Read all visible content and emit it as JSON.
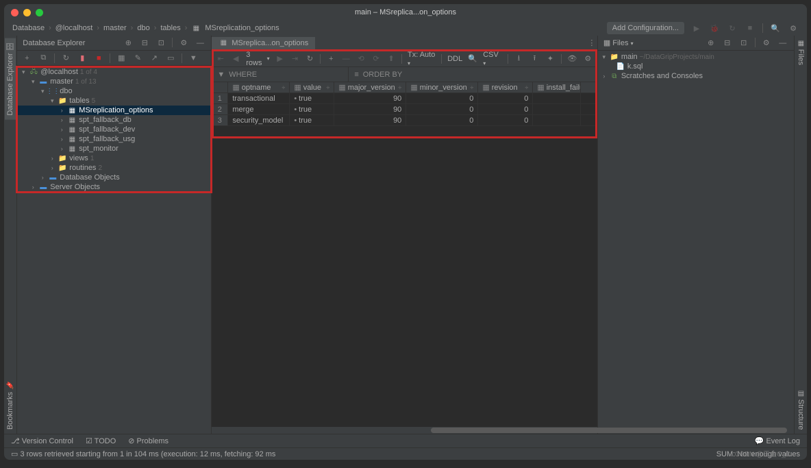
{
  "title": "main – MSreplica...on_options",
  "breadcrumbs": [
    "Database",
    "@localhost",
    "master",
    "dbo",
    "tables",
    "MSreplication_options"
  ],
  "add_config": "Add Configuration...",
  "db_explorer": {
    "title": "Database Explorer",
    "root": "@localhost",
    "root_count": "1 of 4",
    "master": "master",
    "master_count": "1 of 13",
    "dbo": "dbo",
    "tables": "tables",
    "tables_count": "5",
    "table_items": [
      "MSreplication_options",
      "spt_fallback_db",
      "spt_fallback_dev",
      "spt_fallback_usg",
      "spt_monitor"
    ],
    "views": "views",
    "views_count": "1",
    "routines": "routines",
    "routines_count": "2",
    "db_objects": "Database Objects",
    "server_objects": "Server Objects"
  },
  "tab_label": "MSreplica...on_options",
  "grid_toolbar": {
    "rows": "3 rows",
    "tx": "Tx: Auto",
    "ddl": "DDL",
    "csv": "CSV"
  },
  "filter": {
    "where": "WHERE",
    "order_by": "ORDER BY"
  },
  "columns": [
    "optname",
    "value",
    "major_version",
    "minor_version",
    "revision",
    "install_failur"
  ],
  "rows": [
    {
      "n": "1",
      "optname": "transactional",
      "value": "true",
      "major_version": "90",
      "minor_version": "0",
      "revision": "0"
    },
    {
      "n": "2",
      "optname": "merge",
      "value": "true",
      "major_version": "90",
      "minor_version": "0",
      "revision": "0"
    },
    {
      "n": "3",
      "optname": "security_model",
      "value": "true",
      "major_version": "90",
      "minor_version": "0",
      "revision": "0"
    }
  ],
  "files": {
    "title": "Files",
    "main": "main",
    "main_path": "~/DataGripProjects/main",
    "ksql": "k.sql",
    "scratches": "Scratches and Consoles"
  },
  "sidebar_tabs": {
    "db_explorer": "Database Explorer",
    "bookmarks": "Bookmarks",
    "files": "Files",
    "structure": "Structure"
  },
  "bottom": {
    "vc": "Version Control",
    "todo": "TODO",
    "problems": "Problems",
    "event_log": "Event Log"
  },
  "status": "3 rows retrieved starting from 1 in 104 ms (execution: 12 ms, fetching: 92 ms",
  "status_right": "SUM: Not enough values",
  "watermark": "CSDN @王金C_C"
}
